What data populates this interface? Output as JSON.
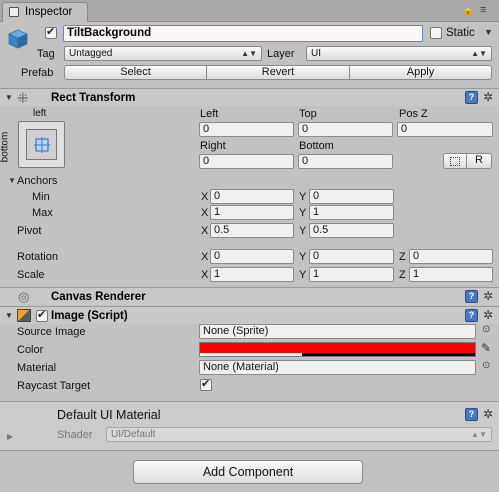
{
  "window": {
    "tab_label": "Inspector"
  },
  "object": {
    "name": "TiltBackground",
    "active": true,
    "static_label": "Static",
    "tag_label": "Tag",
    "tag_value": "Untagged",
    "layer_label": "Layer",
    "layer_value": "UI",
    "prefab_label": "Prefab",
    "prefab_buttons": [
      "Select",
      "Revert",
      "Apply"
    ]
  },
  "rect_transform": {
    "title": "Rect Transform",
    "anchor_top_label": "left",
    "anchor_side_label": "bottom",
    "col_headers": [
      "Left",
      "Top",
      "Pos Z"
    ],
    "col_values": [
      "0",
      "0",
      "0"
    ],
    "row2_headers": [
      "Right",
      "Bottom"
    ],
    "row2_values": [
      "0",
      "0"
    ],
    "raw_button": "R",
    "anchors_label": "Anchors",
    "min_label": "Min",
    "min_x": "0",
    "min_y": "0",
    "max_label": "Max",
    "max_x": "1",
    "max_y": "1",
    "pivot_label": "Pivot",
    "pivot_x": "0.5",
    "pivot_y": "0.5",
    "rotation_label": "Rotation",
    "rotation_x": "0",
    "rotation_y": "0",
    "rotation_z": "0",
    "scale_label": "Scale",
    "scale_x": "1",
    "scale_y": "1",
    "scale_z": "1",
    "axis_x": "X",
    "axis_y": "Y",
    "axis_z": "Z"
  },
  "canvas_renderer": {
    "title": "Canvas Renderer"
  },
  "image_script": {
    "title": "Image (Script)",
    "enabled": true,
    "source_image_label": "Source Image",
    "source_image_value": "None (Sprite)",
    "color_label": "Color",
    "color_value": "#ff0000",
    "material_label": "Material",
    "material_value": "None (Material)",
    "raycast_label": "Raycast Target",
    "raycast_value": true
  },
  "material_section": {
    "title": "Default UI Material",
    "shader_label": "Shader",
    "shader_value": "UI/Default"
  },
  "add_component_label": "Add Component"
}
